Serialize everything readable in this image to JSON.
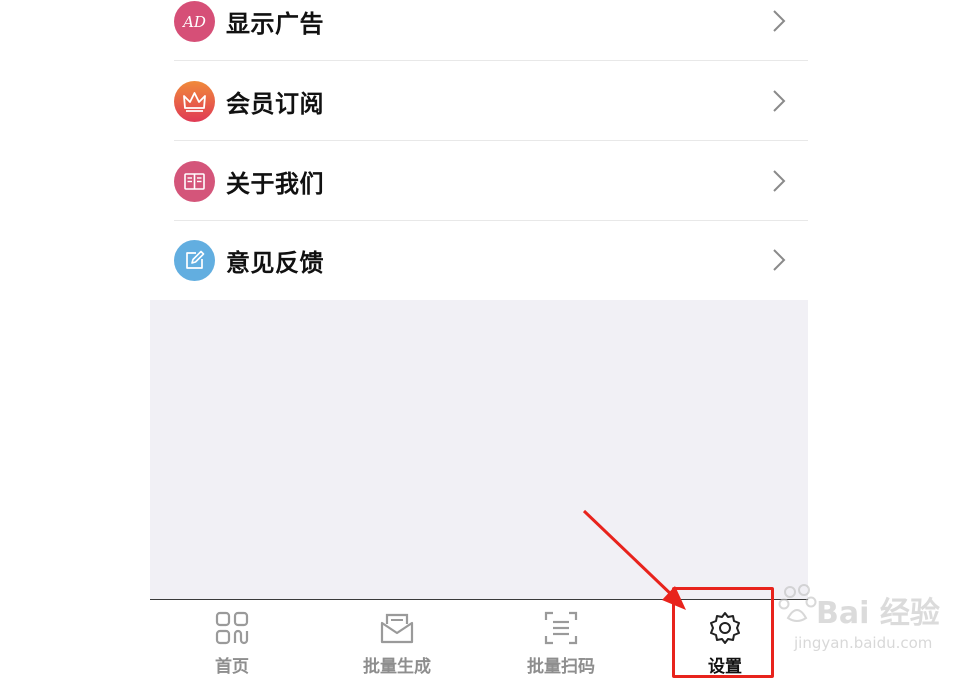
{
  "menu": {
    "items": [
      {
        "label": "显示广告",
        "icon": "ad-icon",
        "icon_color": "#d64f77"
      },
      {
        "label": "会员订阅",
        "icon": "crown-icon",
        "icon_color": "#e8533d"
      },
      {
        "label": "关于我们",
        "icon": "book-icon",
        "icon_color": "#d4557a"
      },
      {
        "label": "意见反馈",
        "icon": "edit-icon",
        "icon_color": "#62aee0"
      }
    ]
  },
  "tabbar": {
    "items": [
      {
        "label": "首页",
        "icon": "grid-icon",
        "active": false
      },
      {
        "label": "批量生成",
        "icon": "envelope-icon",
        "active": false
      },
      {
        "label": "批量扫码",
        "icon": "scan-icon",
        "active": false
      },
      {
        "label": "设置",
        "icon": "gear-icon",
        "active": true
      }
    ]
  },
  "annotation": {
    "color": "#e8231c"
  },
  "watermark": {
    "text": "Bai 经验",
    "sub": "jingyan.baidu.com"
  }
}
